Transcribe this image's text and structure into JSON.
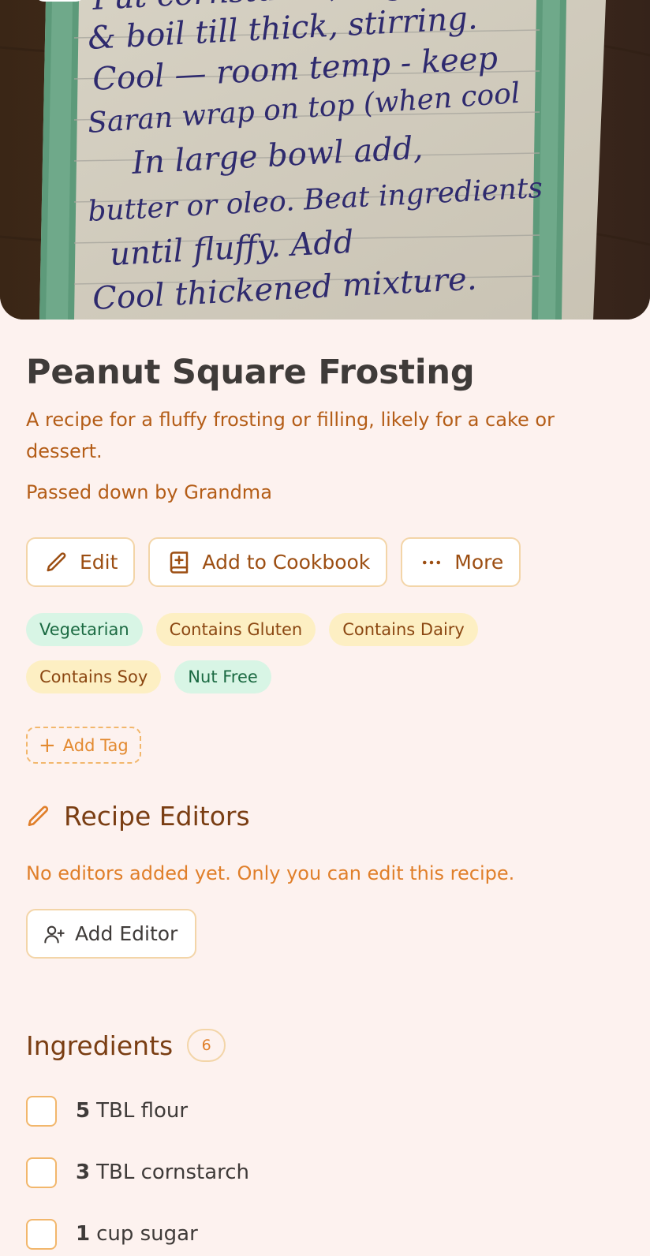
{
  "recipe": {
    "title": "Peanut Square Frosting",
    "description": "A recipe for a fluffy frosting or filling, likely for a cake or dessert.",
    "author": "Passed down by Grandma"
  },
  "actions": {
    "edit_label": "Edit",
    "add_to_cookbook_label": "Add to Cookbook",
    "more_label": "More"
  },
  "tags": [
    {
      "label": "Vegetarian",
      "kind": "green"
    },
    {
      "label": "Contains Gluten",
      "kind": "amber"
    },
    {
      "label": "Contains Dairy",
      "kind": "amber"
    },
    {
      "label": "Contains Soy",
      "kind": "amber"
    },
    {
      "label": "Nut Free",
      "kind": "green"
    }
  ],
  "add_tag_label": "Add Tag",
  "editors": {
    "heading": "Recipe Editors",
    "empty_message": "No editors added yet. Only you can edit this recipe.",
    "add_label": "Add Editor"
  },
  "ingredients": {
    "heading": "Ingredients",
    "count": "6",
    "items": [
      {
        "qty": "5",
        "text": "TBL flour"
      },
      {
        "qty": "3",
        "text": "TBL cornstarch"
      },
      {
        "qty": "1",
        "text": "cup sugar"
      }
    ]
  },
  "hero": {
    "handwriting": [
      "Put cornstarch, sugar, milk",
      "& boil till thick, stirring.",
      "Cool — room temp - keep",
      "Saran wrap on top (when cool",
      "In large bowl add,",
      "butter or oleo. Beat ingredients",
      "until fluffy. Add",
      "Cool thickened mixture."
    ]
  },
  "colors": {
    "background": "#fdf2ef",
    "accent": "#e07f2a",
    "tag_green_bg": "#d8f5e5",
    "tag_amber_bg": "#fdefc3"
  }
}
